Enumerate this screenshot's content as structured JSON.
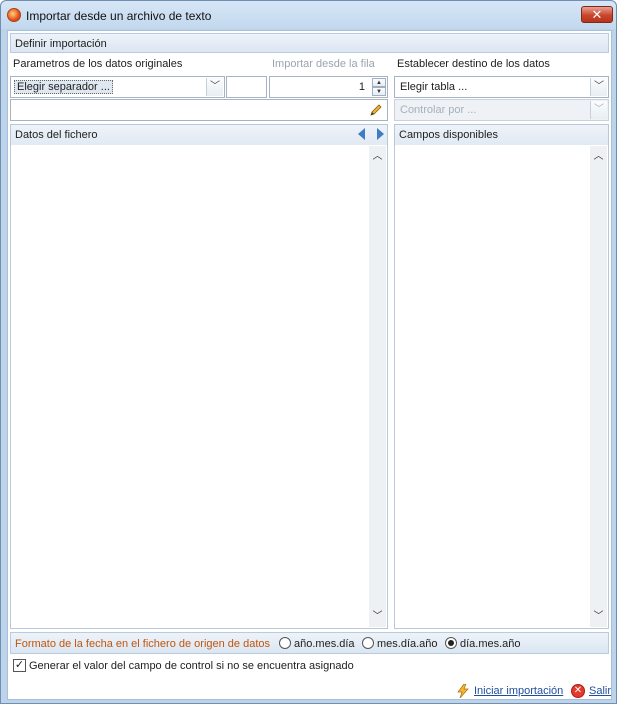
{
  "window": {
    "title": "Importar desde un archivo de texto",
    "close_label": "✕"
  },
  "section": {
    "title": "Definir importación"
  },
  "source": {
    "title": "Parametros de los datos originales",
    "separator_placeholder": "Elegir separador ...",
    "import_from_row_label": "Importar desde la fila",
    "import_from_row_value": "1"
  },
  "destination": {
    "title": "Establecer destino de los datos",
    "table_placeholder": "Elegir tabla ...",
    "control_placeholder": "Controlar por ..."
  },
  "panels": {
    "file_data_title": "Datos del fichero",
    "available_fields_title": "Campos disponibles"
  },
  "date_format": {
    "label": "Formato de la fecha en el fichero de origen de datos",
    "options": [
      "año.mes.día",
      "mes.día.año",
      "día.mes.año"
    ],
    "selected": "día.mes.año"
  },
  "generate_control": {
    "label": "Generar el valor del campo de control si no se encuentra asignado",
    "checked": true
  },
  "footer": {
    "start_label": "Iniciar importación",
    "exit_label": "Salir"
  },
  "icons": {
    "app": "app-icon",
    "pencil": "pencil-icon",
    "bolt": "lightning-icon",
    "exit": "exit-icon"
  },
  "colors": {
    "accent": "#3f7cc4",
    "date_label": "#c0560e",
    "exit": "#e53b2d"
  }
}
